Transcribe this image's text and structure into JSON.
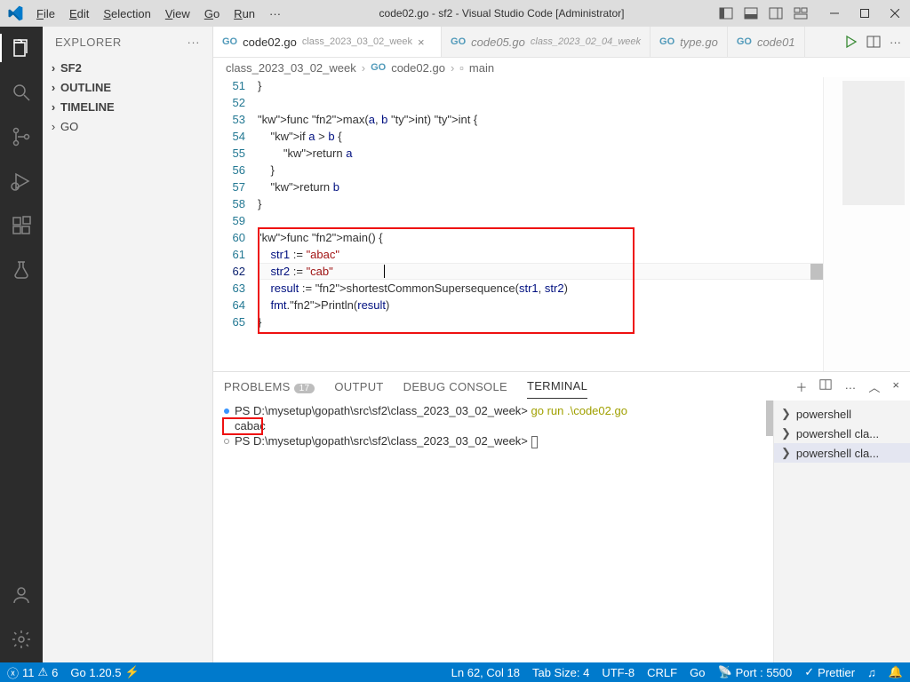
{
  "window": {
    "title": "code02.go - sf2 - Visual Studio Code [Administrator]"
  },
  "menu": {
    "file": "File",
    "edit": "Edit",
    "selection": "Selection",
    "view": "View",
    "go": "Go",
    "run": "Run",
    "more": "···"
  },
  "explorer": {
    "title": "EXPLORER",
    "sections": [
      {
        "label": "SF2",
        "bold": true
      },
      {
        "label": "OUTLINE",
        "bold": true
      },
      {
        "label": "TIMELINE",
        "bold": true
      },
      {
        "label": "GO",
        "bold": false
      }
    ]
  },
  "tabs": [
    {
      "icon": "GO",
      "name": "code02.go",
      "path": "class_2023_03_02_week",
      "active": true,
      "close": true
    },
    {
      "icon": "GO",
      "name": "code05.go",
      "path": "class_2023_02_04_week",
      "dim": true
    },
    {
      "icon": "GO",
      "name": "type.go",
      "italic": true,
      "dim": true
    },
    {
      "icon": "GO",
      "name": "code01",
      "cut": true,
      "dim": true
    }
  ],
  "breadcrumb": {
    "seg1": "class_2023_03_02_week",
    "seg2": "code02.go",
    "seg3": "main"
  },
  "code": {
    "start": 51,
    "current": 62,
    "lines": [
      {
        "n": 51,
        "t": "}"
      },
      {
        "n": 52,
        "t": ""
      },
      {
        "n": 53,
        "t": "func max(a, b int) int {"
      },
      {
        "n": 54,
        "t": "    if a > b {"
      },
      {
        "n": 55,
        "t": "        return a"
      },
      {
        "n": 56,
        "t": "    }"
      },
      {
        "n": 57,
        "t": "    return b"
      },
      {
        "n": 58,
        "t": "}"
      },
      {
        "n": 59,
        "t": ""
      },
      {
        "n": 60,
        "t": "func main() {"
      },
      {
        "n": 61,
        "t": "    str1 := \"abac\""
      },
      {
        "n": 62,
        "t": "    str2 := \"cab\""
      },
      {
        "n": 63,
        "t": "    result := shortestCommonSupersequence(str1, str2)"
      },
      {
        "n": 64,
        "t": "    fmt.Println(result)"
      },
      {
        "n": 65,
        "t": "}"
      }
    ]
  },
  "panel": {
    "tabs": {
      "problems": "PROBLEMS",
      "problems_count": "17",
      "output": "OUTPUT",
      "debug": "DEBUG CONSOLE",
      "terminal": "TERMINAL"
    }
  },
  "terminal": {
    "line1_prompt": "PS D:\\mysetup\\gopath\\src\\sf2\\class_2023_03_02_week> ",
    "line1_cmd": "go run .\\code02.go",
    "line2": "cabac",
    "line3_prompt": "PS D:\\mysetup\\gopath\\src\\sf2\\class_2023_03_02_week> ",
    "side": [
      {
        "label": "powershell"
      },
      {
        "label": "powershell  cla..."
      },
      {
        "label": "powershell  cla...",
        "active": true
      }
    ]
  },
  "status": {
    "errors": "11",
    "warnings": "6",
    "go": "Go 1.20.5",
    "pos": "Ln 62, Col 18",
    "tab": "Tab Size: 4",
    "enc": "UTF-8",
    "eol": "CRLF",
    "lang": "Go",
    "port": "Port : 5500",
    "prettier": "Prettier"
  }
}
